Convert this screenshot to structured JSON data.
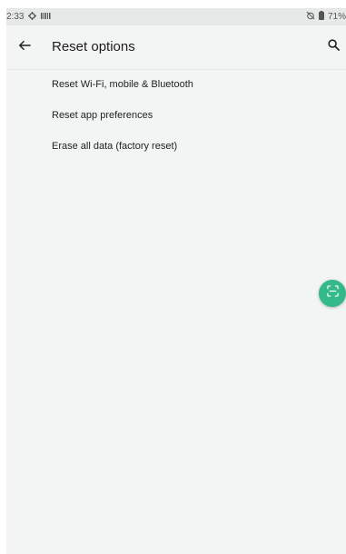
{
  "status_bar": {
    "time": "2:33",
    "battery": "71%",
    "icons": [
      "gear-icon",
      "barcode-icon",
      "no-alarm-icon",
      "battery-icon"
    ]
  },
  "app_bar": {
    "title": "Reset options",
    "back_icon": "arrow-back-icon",
    "search_icon": "search-icon"
  },
  "items": [
    {
      "label": "Reset Wi-Fi, mobile & Bluetooth"
    },
    {
      "label": "Reset app preferences"
    },
    {
      "label": "Erase all data (factory reset)"
    }
  ],
  "fab": {
    "icon": "scan-icon",
    "color": "#34b98a"
  }
}
